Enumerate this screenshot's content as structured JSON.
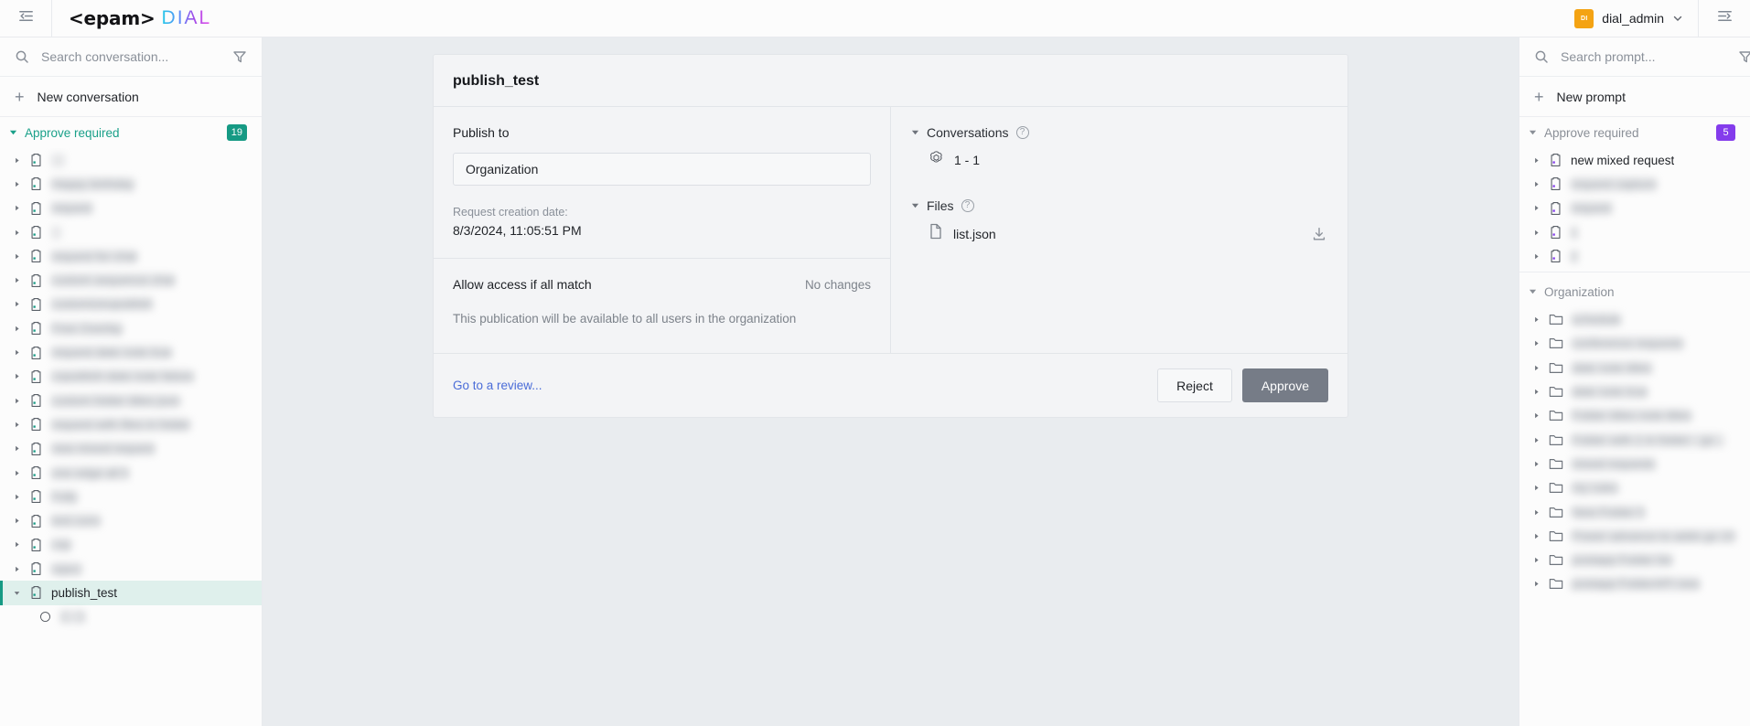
{
  "topbar": {
    "collapse_left_icon": "panel-collapse-left-icon",
    "brand_epam": "<epam>",
    "brand_dial": "DIAL",
    "user_initials": "DI",
    "user_name": "dial_admin",
    "chevron": "⌄",
    "collapse_right_icon": "panel-collapse-right-icon"
  },
  "left_sidebar": {
    "search_placeholder": "Search conversation...",
    "search_value": "",
    "new_conversation_label": "New conversation",
    "plus": "+",
    "section": {
      "title": "Approve required",
      "badge": "19",
      "badge_color": "#169a84"
    },
    "items": [
      {
        "name": "    ",
        "blurred": true
      },
      {
        "name": "Happy birthday",
        "blurred": true
      },
      {
        "name": "request",
        "blurred": true
      },
      {
        "name": "   ",
        "blurred": true
      },
      {
        "name": "request for chat",
        "blurred": true
      },
      {
        "name": "custom sequence chat",
        "blurred": true
      },
      {
        "name": "customizeupublish",
        "blurred": true
      },
      {
        "name": "Free Overlay",
        "blurred": true
      },
      {
        "name": "request date note true",
        "blurred": true
      },
      {
        "name": "copublish date note falses",
        "blurred": true
      },
      {
        "name": "custom folder titles json",
        "blurred": true
      },
      {
        "name": "request with files in folder",
        "blurred": true
      },
      {
        "name": "new mixed request",
        "blurred": true
      },
      {
        "name": "one edge all 5",
        "blurred": true
      },
      {
        "name": "Folly",
        "blurred": true
      },
      {
        "name": "test conv",
        "blurred": true
      },
      {
        "name": "cop",
        "blurred": true
      },
      {
        "name": "reject",
        "blurred": true
      },
      {
        "name": "publish_test",
        "blurred": false,
        "selected": true
      }
    ],
    "selected_child": {
      "name": "1 - 1",
      "blurred": true
    }
  },
  "right_sidebar": {
    "search_placeholder": "Search prompt...",
    "search_value": "",
    "new_prompt_label": "New prompt",
    "plus": "+",
    "section": {
      "title": "Approve required",
      "badge": "5",
      "badge_color": "#843cec"
    },
    "prompt_items": [
      {
        "name": "new mixed request",
        "blurred": false
      },
      {
        "name": "request capture",
        "blurred": true
      },
      {
        "name": "request",
        "blurred": true
      },
      {
        "name": "1",
        "blurred": true
      },
      {
        "name": "2",
        "blurred": true
      }
    ],
    "org_section": {
      "title": "Organization",
      "blurred": true
    },
    "folders": [
      {
        "name": "schedule",
        "blurred": true
      },
      {
        "name": "conference requests",
        "blurred": true
      },
      {
        "name": "date note titles",
        "blurred": true
      },
      {
        "name": "date note true",
        "blurred": true
      },
      {
        "name": "Folder titles note titles",
        "blurred": true
      },
      {
        "name": "Folder with 1 in folder - go ..",
        "blurred": true
      },
      {
        "name": "mixed requests",
        "blurred": true
      },
      {
        "name": "my rules",
        "blurred": true
      },
      {
        "name": "New Folder 5",
        "blurred": true
      },
      {
        "name": "Power advance to adds go 10",
        "blurred": true
      },
      {
        "name": "postapp Folder list",
        "blurred": true
      },
      {
        "name": "postapp FolderAPI new",
        "blurred": true
      }
    ]
  },
  "main": {
    "card_title": "publish_test",
    "publish_to_label": "Publish to",
    "publish_to_value": "Organization",
    "request_date_label": "Request creation date:",
    "request_date_value": "8/3/2024, 11:05:51 PM",
    "access_title": "Allow access if all match",
    "access_changes": "No changes",
    "access_description": "This publication will be available to all users in the organization",
    "conversations_group": {
      "title": "Conversations",
      "help": "?",
      "caret": "▾"
    },
    "conversation_item": "1 - 1",
    "files_group": {
      "title": "Files",
      "help": "?",
      "caret": "▾"
    },
    "file_item": "list.json",
    "download_icon": "download-icon",
    "review_link": "Go to a review...",
    "reject_label": "Reject",
    "approve_label": "Approve"
  }
}
